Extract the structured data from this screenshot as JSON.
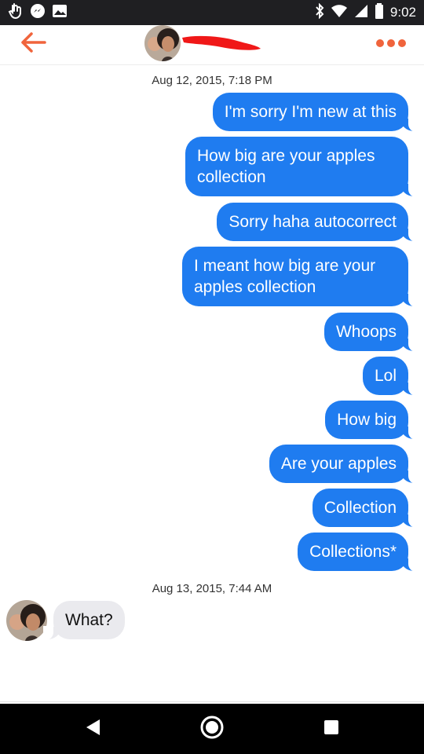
{
  "status_bar": {
    "time": "9:02",
    "left_icons": [
      "touch-icon",
      "messenger-icon",
      "image-icon"
    ],
    "right_icons": [
      "bluetooth-icon",
      "wifi-icon",
      "signal-icon",
      "battery-icon"
    ]
  },
  "header": {
    "back_icon": "arrow-left-icon",
    "more_icon": "more-dots-icon",
    "accent_color": "#f0643c"
  },
  "conversation": {
    "timestamp_1": "Aug 12, 2015, 7:18 PM",
    "outgoing": [
      "I'm sorry I'm new at this",
      "How big are your apples collection",
      "Sorry haha autocorrect",
      "I meant how big are your apples collection",
      "Whoops",
      "Lol",
      "How big",
      "Are your apples",
      "Collection",
      "Collections*"
    ],
    "timestamp_2": "Aug 13, 2015, 7:44 AM",
    "incoming": [
      "What?"
    ],
    "outgoing_color": "#1f7cf0",
    "incoming_color": "#eaeaee"
  },
  "nav_bar": {
    "icons": [
      "back-triangle-icon",
      "home-circle-icon",
      "recents-square-icon"
    ]
  }
}
